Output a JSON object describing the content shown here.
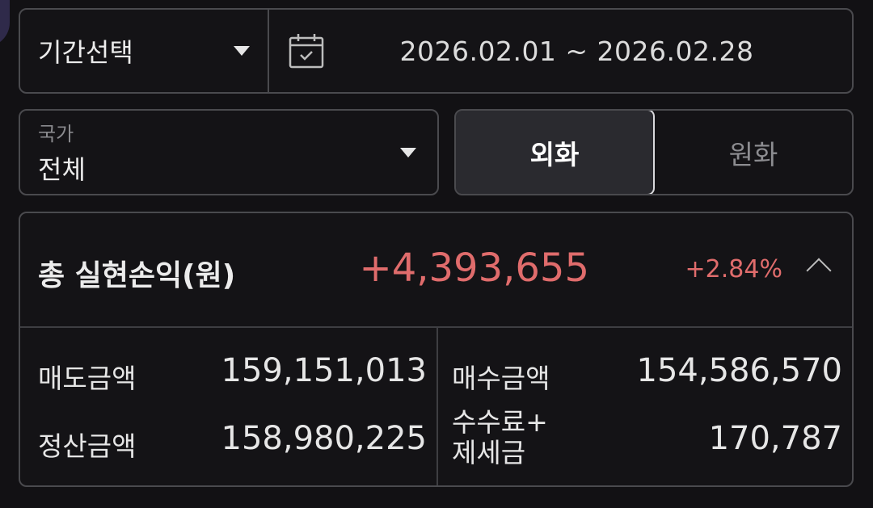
{
  "filters": {
    "period_label": "기간선택",
    "date_range": "2026.02.01 ~ 2026.02.28",
    "country_caption": "국가",
    "country_value": "전체"
  },
  "currency_toggle": {
    "options": [
      "외화",
      "원화"
    ],
    "selected": "외화"
  },
  "summary": {
    "total_label": "총 실현손익(원)",
    "total_value": "+4,393,655",
    "total_rate": "+2.84%",
    "rows": [
      {
        "label": "매도금액",
        "value": "159,151,013"
      },
      {
        "label": "매수금액",
        "value": "154,586,570"
      },
      {
        "label": "정산금액",
        "value": "158,980,225"
      },
      {
        "label_line1": "수수료+",
        "label_line2": "제세금",
        "value": "170,787"
      }
    ]
  },
  "colors": {
    "background": "#121114",
    "border": "#4a4a4e",
    "profit_red": "#e06c6c",
    "active_toggle_bg": "#2a2a2f"
  },
  "icons": [
    "chevron-down-icon",
    "calendar-check-icon",
    "chevron-up-icon"
  ]
}
